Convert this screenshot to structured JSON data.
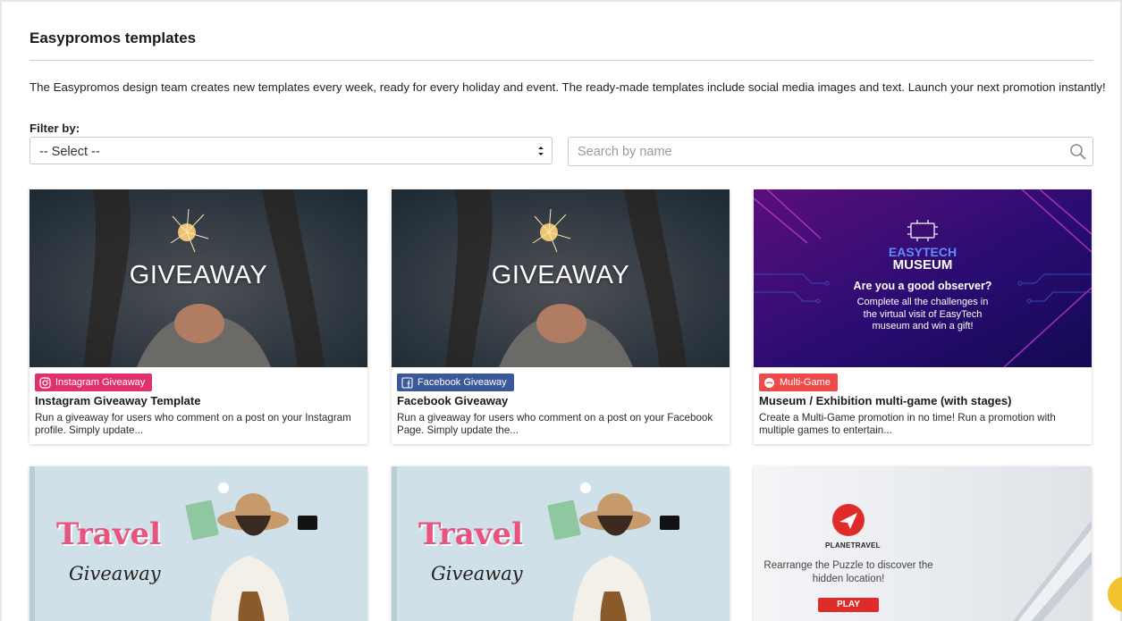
{
  "page": {
    "title": "Easypromos templates",
    "description": "The Easypromos design team creates new templates every week, ready for every holiday and event. The ready-made templates include social media images and text. Launch your next promotion instantly!"
  },
  "filter": {
    "label": "Filter by:",
    "select_value": "-- Select --",
    "search_placeholder": "Search by name"
  },
  "colors": {
    "instagram_badge": "#e0306d",
    "facebook_badge": "#3b5998",
    "multigame_badge": "#ef4a4a"
  },
  "cards": [
    {
      "image_text": "GIVEAWAY",
      "badge": "Instagram Giveaway",
      "badge_icon": "instagram-icon",
      "title": "Instagram Giveaway Template",
      "description": "Run a giveaway for users who comment on a post on your Instagram profile. Simply update..."
    },
    {
      "image_text": "GIVEAWAY",
      "badge": "Facebook Giveaway",
      "badge_icon": "facebook-icon",
      "title": "Facebook Giveaway",
      "description": "Run a giveaway for users who comment on a post on your Facebook Page. Simply update the..."
    },
    {
      "image_title_1": "EASYTECH",
      "image_title_2": "MUSEUM",
      "image_question": "Are you a good observer?",
      "image_sub": "Complete all the challenges in the virtual visit of EasyTech museum and win a gift!",
      "badge": "Multi-Game",
      "badge_icon": "gamepad-icon",
      "title": "Museum / Exhibition multi-game (with stages)",
      "description": "Create a Multi-Game promotion in no time! Run a promotion with multiple games to entertain..."
    },
    {
      "image_word_1": "Travel",
      "image_word_2": "Giveaway"
    },
    {
      "image_word_1": "Travel",
      "image_word_2": "Giveaway"
    },
    {
      "brand": "PLANETRAVEL",
      "image_text": "Rearrange the Puzzle to discover the hidden location!",
      "play": "PLAY"
    }
  ]
}
